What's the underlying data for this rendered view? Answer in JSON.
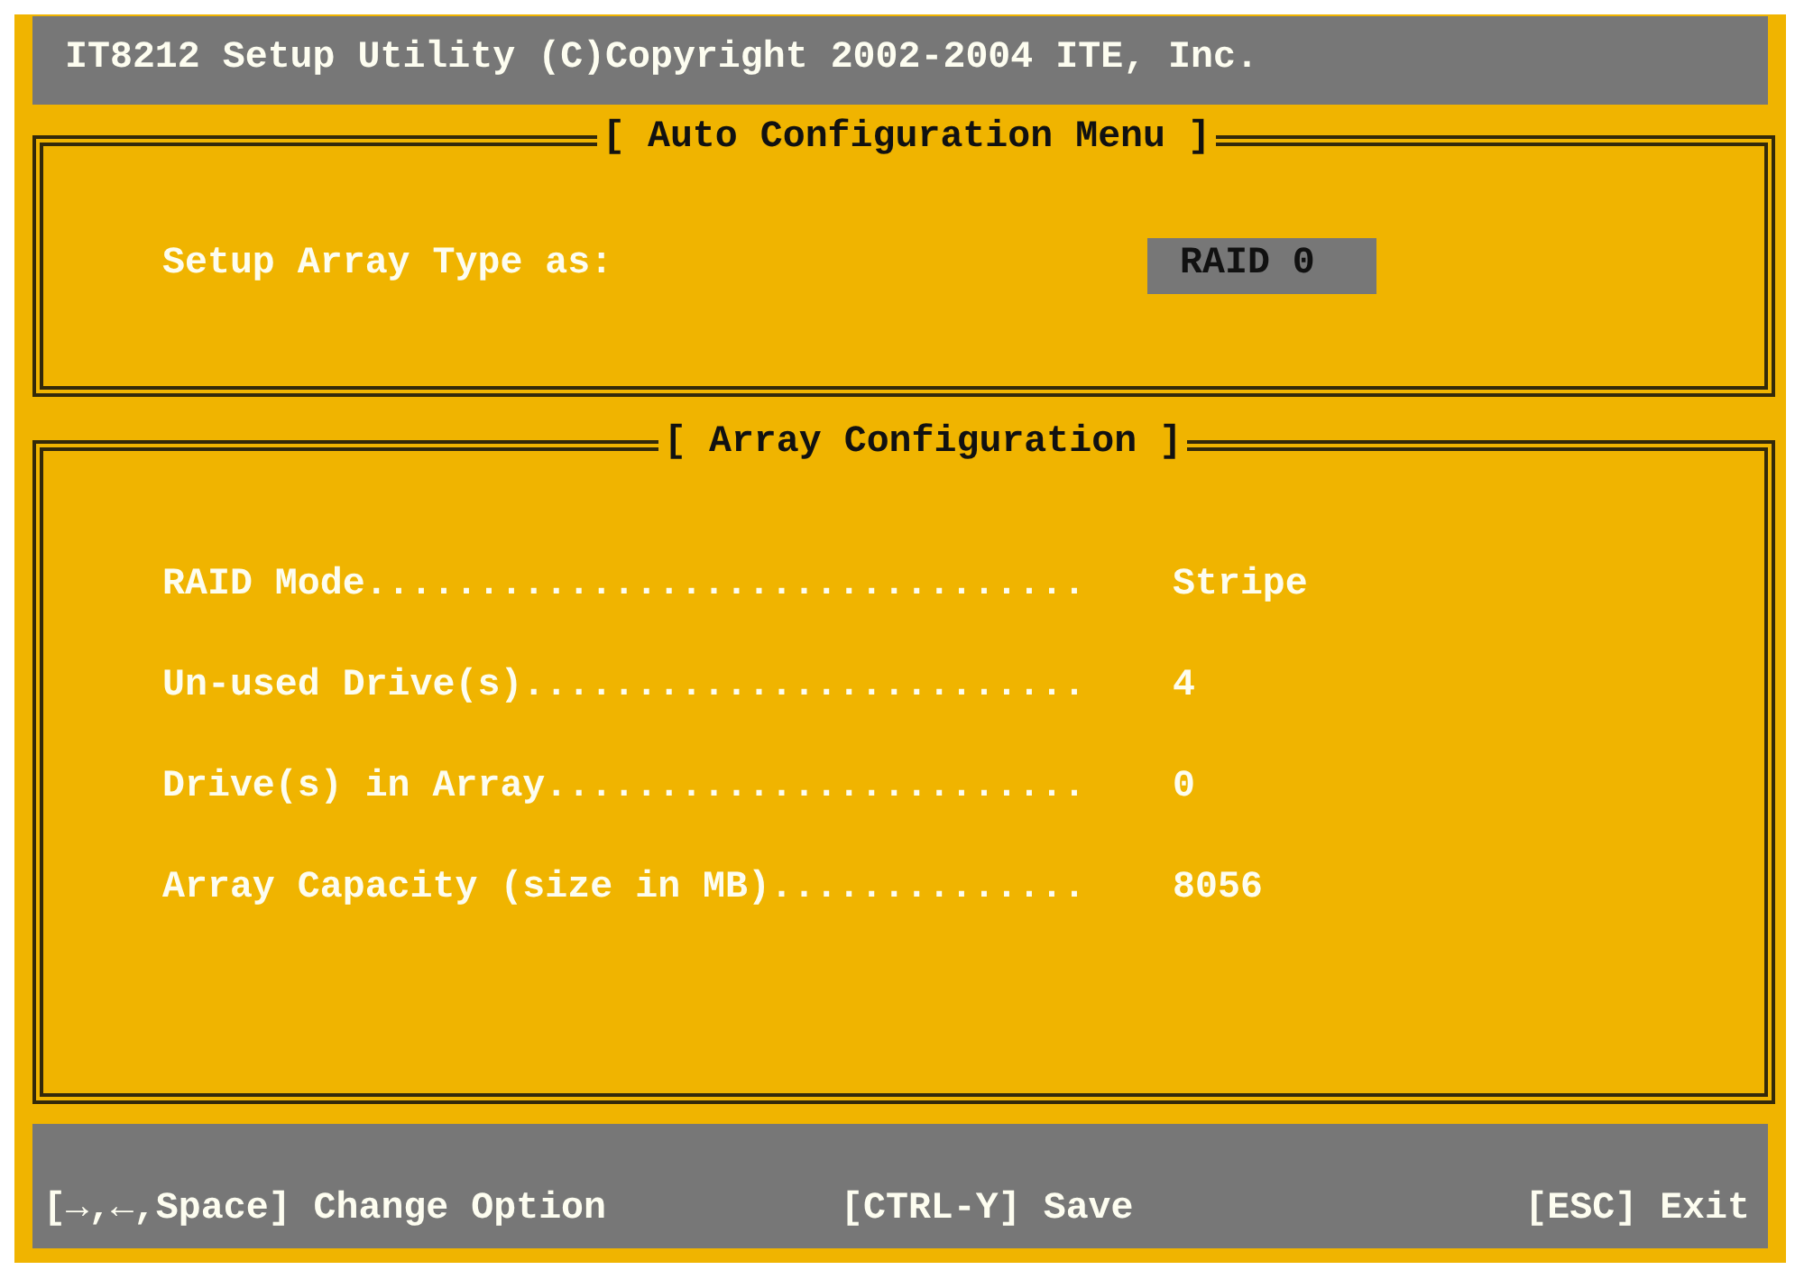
{
  "window": {
    "title": "IT8212 Setup Utility (C)Copyright 2002-2004 ITE, Inc."
  },
  "auto_configuration": {
    "heading": "[ Auto Configuration Menu ]",
    "label": "Setup Array Type as:",
    "value": "RAID 0"
  },
  "array_configuration": {
    "heading": "[ Array Configuration ]",
    "rows": [
      {
        "label": "RAID Mode................................",
        "value": "Stripe"
      },
      {
        "label": "Un-used Drive(s).........................",
        "value": "4"
      },
      {
        "label": "Drive(s) in Array........................",
        "value": "0"
      },
      {
        "label": "Array Capacity (size in MB)..............",
        "value": "8056"
      }
    ]
  },
  "key_hints": [
    "[→,←,Space] Change Option",
    "[CTRL-Y] Save",
    "[ESC] Exit"
  ]
}
